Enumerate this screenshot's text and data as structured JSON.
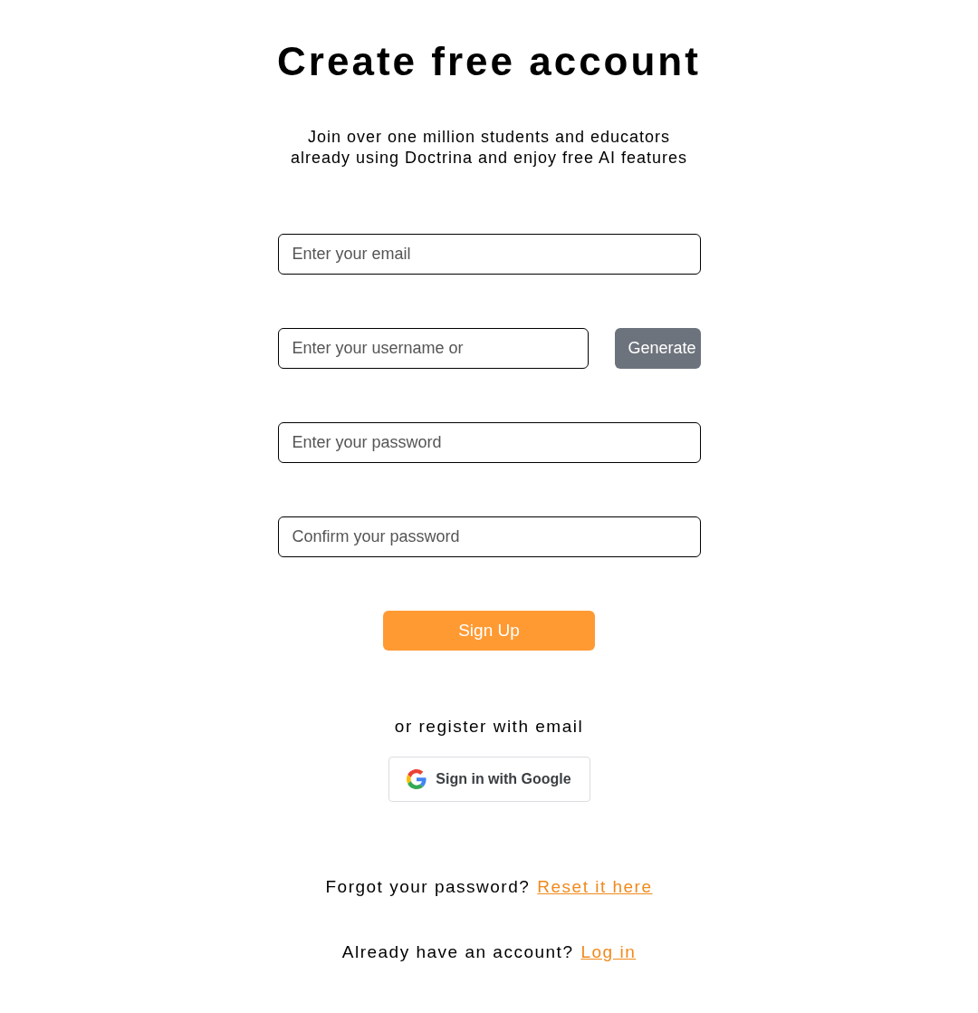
{
  "title": "Create free account",
  "subtitle": "Join over one million students and educators already using Doctrina and enjoy free AI features",
  "fields": [
    {
      "kind": "full",
      "placeholder": "Enter your email"
    },
    {
      "kind": "with_button",
      "placeholder": "Enter your username or",
      "button": "Generate"
    },
    {
      "kind": "full",
      "placeholder": "Enter your password"
    },
    {
      "kind": "full",
      "placeholder": "Confirm your password"
    }
  ],
  "submit": "Sign Up",
  "divider_text": "or register with email",
  "google_button": "Sign in with Google",
  "links": [
    {
      "text": "Forgot your password?",
      "link": "Reset it here"
    },
    {
      "text": "Already have an account?",
      "link": "Log in"
    }
  ]
}
